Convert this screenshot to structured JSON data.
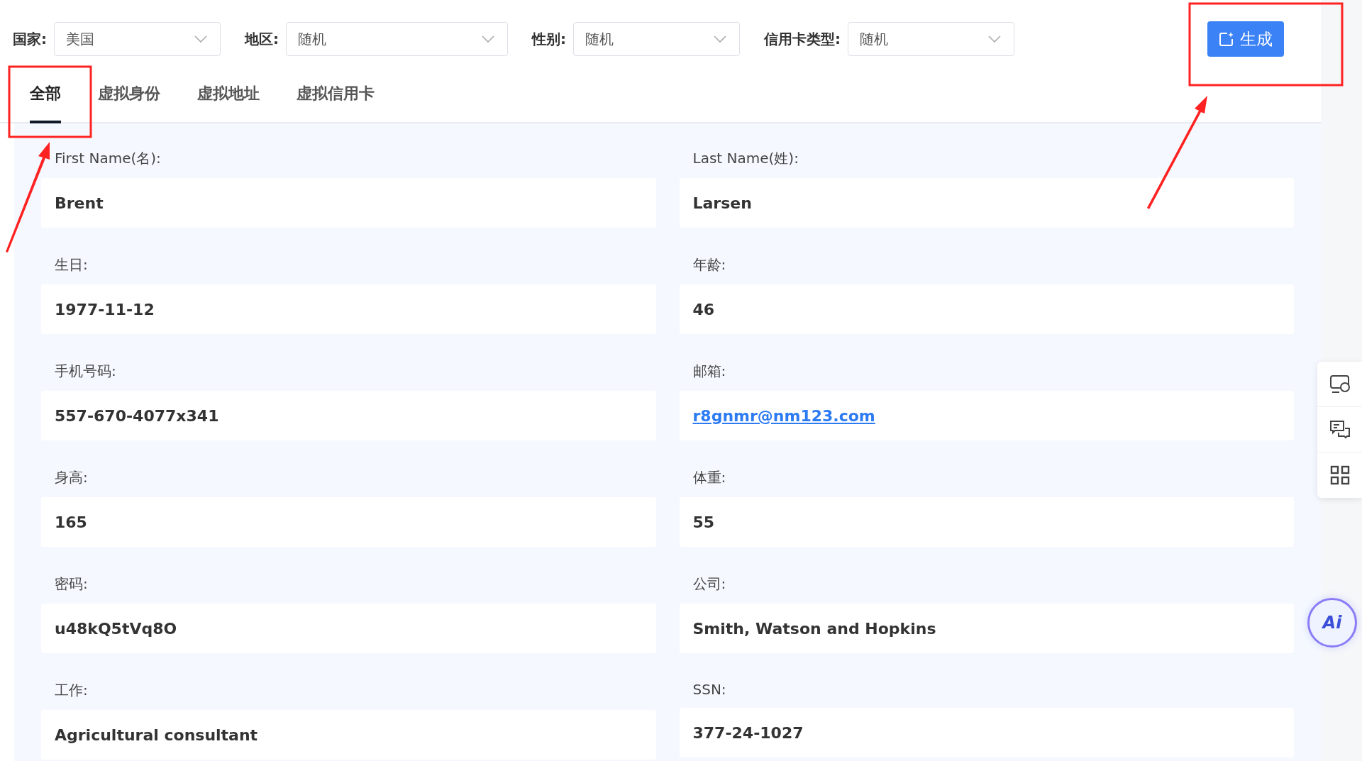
{
  "filters": [
    {
      "label": "国家:",
      "value": "美国"
    },
    {
      "label": "地区:",
      "value": "随机"
    },
    {
      "label": "性别:",
      "value": "随机"
    },
    {
      "label": "信用卡类型:",
      "value": "随机"
    }
  ],
  "generate_button": "生成",
  "tabs": [
    {
      "label": "全部",
      "selected": true
    },
    {
      "label": "虚拟身份",
      "selected": false
    },
    {
      "label": "虚拟地址",
      "selected": false
    },
    {
      "label": "虚拟信用卡",
      "selected": false
    }
  ],
  "fields": [
    {
      "label": "First Name(名):",
      "value": "Brent",
      "kind": "text"
    },
    {
      "label": "Last Name(姓):",
      "value": "Larsen",
      "kind": "text"
    },
    {
      "label": "生日:",
      "value": "1977-11-12",
      "kind": "text"
    },
    {
      "label": "年龄:",
      "value": "46",
      "kind": "text"
    },
    {
      "label": "手机号码:",
      "value": "557-670-4077x341",
      "kind": "text"
    },
    {
      "label": "邮箱:",
      "value": "r8gnmr@nm123.com",
      "kind": "link"
    },
    {
      "label": "身高:",
      "value": "165",
      "kind": "text"
    },
    {
      "label": "体重:",
      "value": "55",
      "kind": "text"
    },
    {
      "label": "密码:",
      "value": "u48kQ5tVq8O",
      "kind": "text"
    },
    {
      "label": "公司:",
      "value": "Smith, Watson and Hopkins",
      "kind": "text"
    },
    {
      "label": "工作:",
      "value": "Agricultural consultant",
      "kind": "text"
    },
    {
      "label": "SSN:",
      "value": "377-24-1027",
      "kind": "text"
    }
  ],
  "ai_badge": "Ai"
}
